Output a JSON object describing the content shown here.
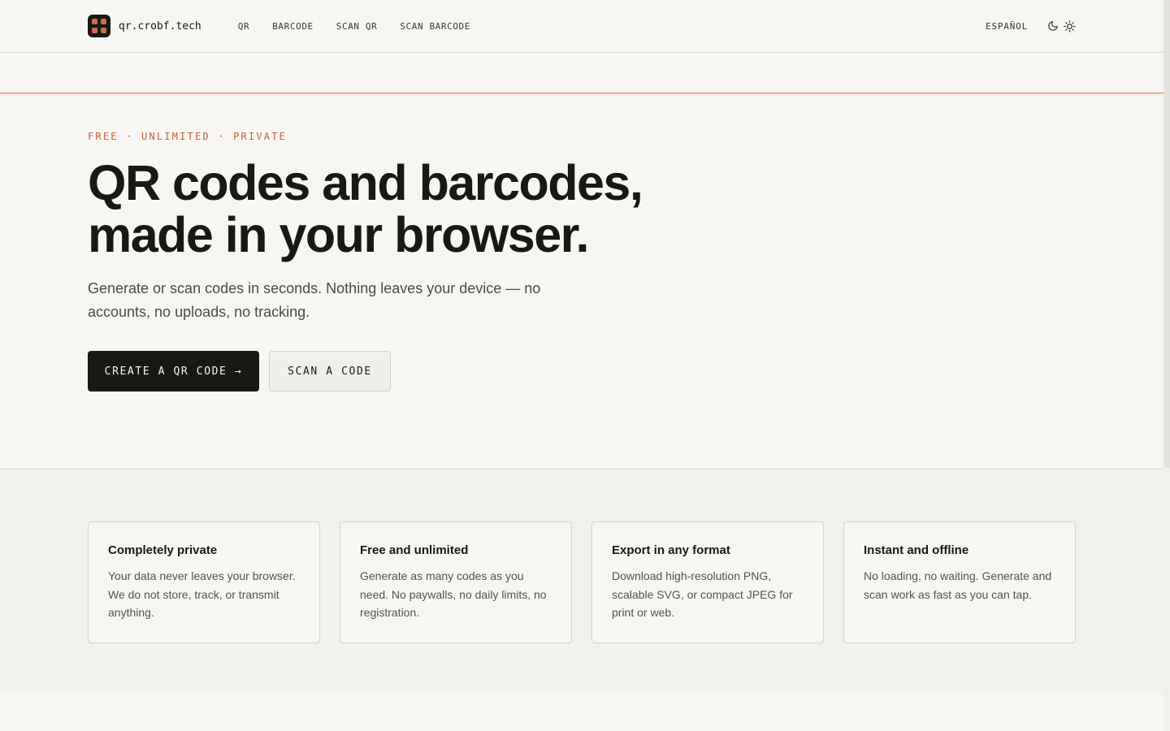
{
  "brand": {
    "name": "qr.crobf.tech",
    "icon": "qr-logo-icon"
  },
  "nav": [
    {
      "label": "QR"
    },
    {
      "label": "BARCODE"
    },
    {
      "label": "SCAN QR"
    },
    {
      "label": "SCAN BARCODE"
    }
  ],
  "header": {
    "language_label": "ESPAÑOL",
    "theme_icons": [
      "moon-icon",
      "sun-icon"
    ]
  },
  "hero": {
    "eyebrow": "FREE · UNLIMITED · PRIVATE",
    "title_line1": "QR codes and barcodes,",
    "title_line2": "made in your browser.",
    "subtitle": "Generate or scan codes in seconds. Nothing leaves your device — no accounts, no uploads, no tracking.",
    "primary_cta": "CREATE A QR CODE →",
    "secondary_cta": "SCAN A CODE"
  },
  "features": [
    {
      "title": "Completely private",
      "body": "Your data never leaves your browser. We do not store, track, or transmit anything."
    },
    {
      "title": "Free and unlimited",
      "body": "Generate as many codes as you need. No paywalls, no daily limits, no registration."
    },
    {
      "title": "Export in any format",
      "body": "Download high-resolution PNG, scalable SVG, or compact JPEG for print or web."
    },
    {
      "title": "Instant and offline",
      "body": "No loading, no waiting. Generate and scan work as fast as you can tap."
    }
  ],
  "colors": {
    "accent": "#c8603f",
    "ink": "#1a1815",
    "background": "#f7f6f2"
  }
}
